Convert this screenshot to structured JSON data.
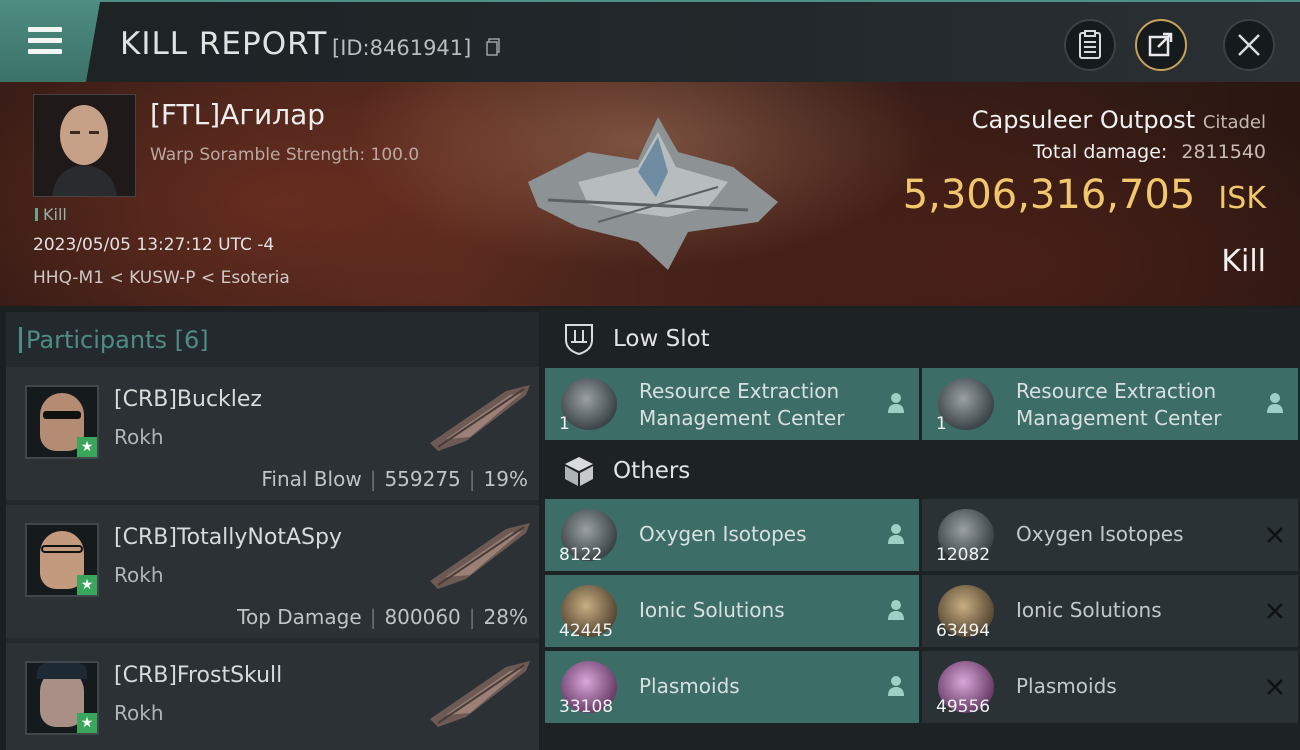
{
  "header": {
    "title": "KILL REPORT",
    "report_id": "[ID:8461941]"
  },
  "victim": {
    "pilot_name": "[FTL]Агилар",
    "scramble": "Warp Soramble Strength: 100.0",
    "kill_tag": "Kill",
    "datetime": "2023/05/05 13:27:12 UTC -4",
    "location": "HHQ-M1 < KUSW-P < Esoteria",
    "structure_name": "Capsuleer Outpost",
    "structure_class": "Citadel",
    "total_damage_label": "Total damage:",
    "total_damage": "2811540",
    "isk_value": "5,306,316,705",
    "isk_unit": "ISK",
    "result": "Kill"
  },
  "participants": {
    "title": "Participants",
    "count": "[6]",
    "rows": [
      {
        "name": "[CRB]Bucklez",
        "ship": "Rokh",
        "role": "Final Blow",
        "damage": "559275",
        "percent": "19%"
      },
      {
        "name": "[CRB]TotallyNotASpy",
        "ship": "Rokh",
        "role": "Top Damage",
        "damage": "800060",
        "percent": "28%"
      },
      {
        "name": "[CRB]FrostSkull",
        "ship": "Rokh",
        "role": "",
        "damage": "",
        "percent": ""
      }
    ]
  },
  "low_slot": {
    "title": "Low Slot",
    "items": [
      {
        "name_line1": "Resource Extraction",
        "name_line2": "Management Center",
        "qty": "1"
      },
      {
        "name_line1": "Resource Extraction",
        "name_line2": "Management Center",
        "qty": "1"
      }
    ]
  },
  "others": {
    "title": "Others",
    "items": [
      {
        "name": "Oxygen Isotopes",
        "qty": "8122"
      },
      {
        "name": "Oxygen Isotopes",
        "qty": "12082"
      },
      {
        "name": "Ionic Solutions",
        "qty": "42445"
      },
      {
        "name": "Ionic Solutions",
        "qty": "63494"
      },
      {
        "name": "Plasmoids",
        "qty": "33108"
      },
      {
        "name": "Plasmoids",
        "qty": "49556"
      }
    ]
  },
  "colors": {
    "accent": "#4f8d84",
    "isk_gold": "#f1c76c",
    "highlight_item": "#3c6d66"
  }
}
